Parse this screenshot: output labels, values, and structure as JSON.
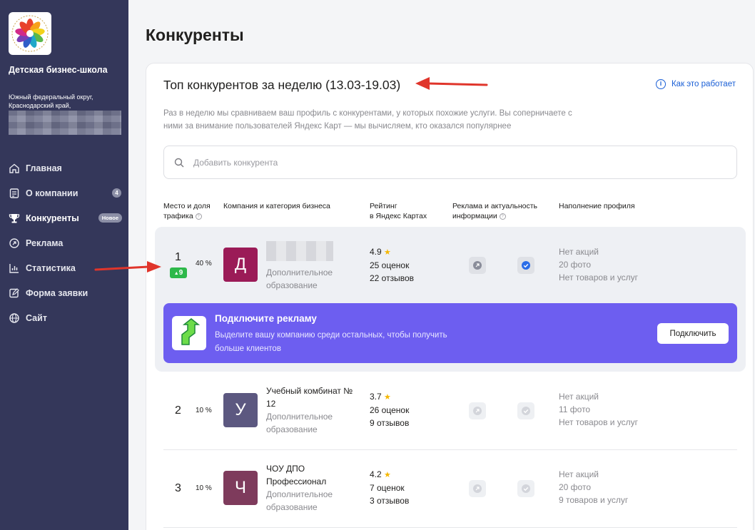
{
  "sidebar": {
    "org_name": "Детская бизнес-школа",
    "org_address": "Южный федеральный округ, Краснодарский край,",
    "nav": [
      {
        "label": "Главная",
        "icon": "home-icon"
      },
      {
        "label": "О компании",
        "icon": "document-icon",
        "badge": "4"
      },
      {
        "label": "Конкуренты",
        "icon": "trophy-icon",
        "badge": "Новое",
        "active": true
      },
      {
        "label": "Реклама",
        "icon": "ads-icon"
      },
      {
        "label": "Статистика",
        "icon": "chart-icon"
      },
      {
        "label": "Форма заявки",
        "icon": "form-icon"
      },
      {
        "label": "Сайт",
        "icon": "globe-icon"
      }
    ]
  },
  "page": {
    "title": "Конкуренты"
  },
  "card": {
    "title": "Топ конкурентов за неделю (13.03-19.03)",
    "how_link": "Как это работает",
    "description": "Раз в неделю мы сравниваем ваш профиль с конкурентами, у которых похожие услуги. Вы соперничаете с ними за внимание пользователей Яндекс Карт — мы вычисляем, кто оказался популярнее",
    "search_placeholder": "Добавить конкурента"
  },
  "columns": {
    "place_line1": "Место и доля",
    "place_line2": "трафика",
    "company": "Компания и категория бизнеса",
    "rating_line1": "Рейтинг",
    "rating_line2": "в Яндекс Картах",
    "ads_line1": "Реклама и актуальность",
    "ads_line2": "информации",
    "fill": "Наполнение профиля"
  },
  "rows": [
    {
      "rank": "1",
      "share": "40 %",
      "delta": "9",
      "letter": "Д",
      "name": "",
      "category": "Дополнительное образование",
      "rating": "4.9",
      "reviews_count": "25 оценок",
      "reviews_text": "22 отзывов",
      "promos": "Нет акций",
      "photos": "20 фото",
      "goods": "Нет товаров и услуг",
      "avatar_color": "#9b1b57"
    },
    {
      "rank": "2",
      "share": "10 %",
      "letter": "У",
      "name": "Учебный комбинат № 12",
      "category": "Дополнительное образование",
      "rating": "3.7",
      "reviews_count": "26 оценок",
      "reviews_text": "9 отзывов",
      "promos": "Нет акций",
      "photos": "11 фото",
      "goods": "Нет товаров и услуг",
      "avatar_color": "#5c5880"
    },
    {
      "rank": "3",
      "share": "10 %",
      "letter": "Ч",
      "name": "ЧОУ ДПО Профессионал",
      "category": "Дополнительное образование",
      "rating": "4.2",
      "reviews_count": "7 оценок",
      "reviews_text": "3 отзывов",
      "promos": "Нет акций",
      "photos": "20 фото",
      "goods": "9 товаров и услуг",
      "avatar_color": "#7e3b5c"
    }
  ],
  "promo": {
    "title": "Подключите рекламу",
    "text": "Выделите вашу компанию среди остальных, чтобы получить больше клиентов",
    "button": "Подключить",
    "color": "#6d5ef0"
  },
  "colors": {
    "sidebar": "#34375a",
    "link": "#1a5fd6",
    "delta": "#2db84a",
    "arrow": "#e0352b"
  }
}
